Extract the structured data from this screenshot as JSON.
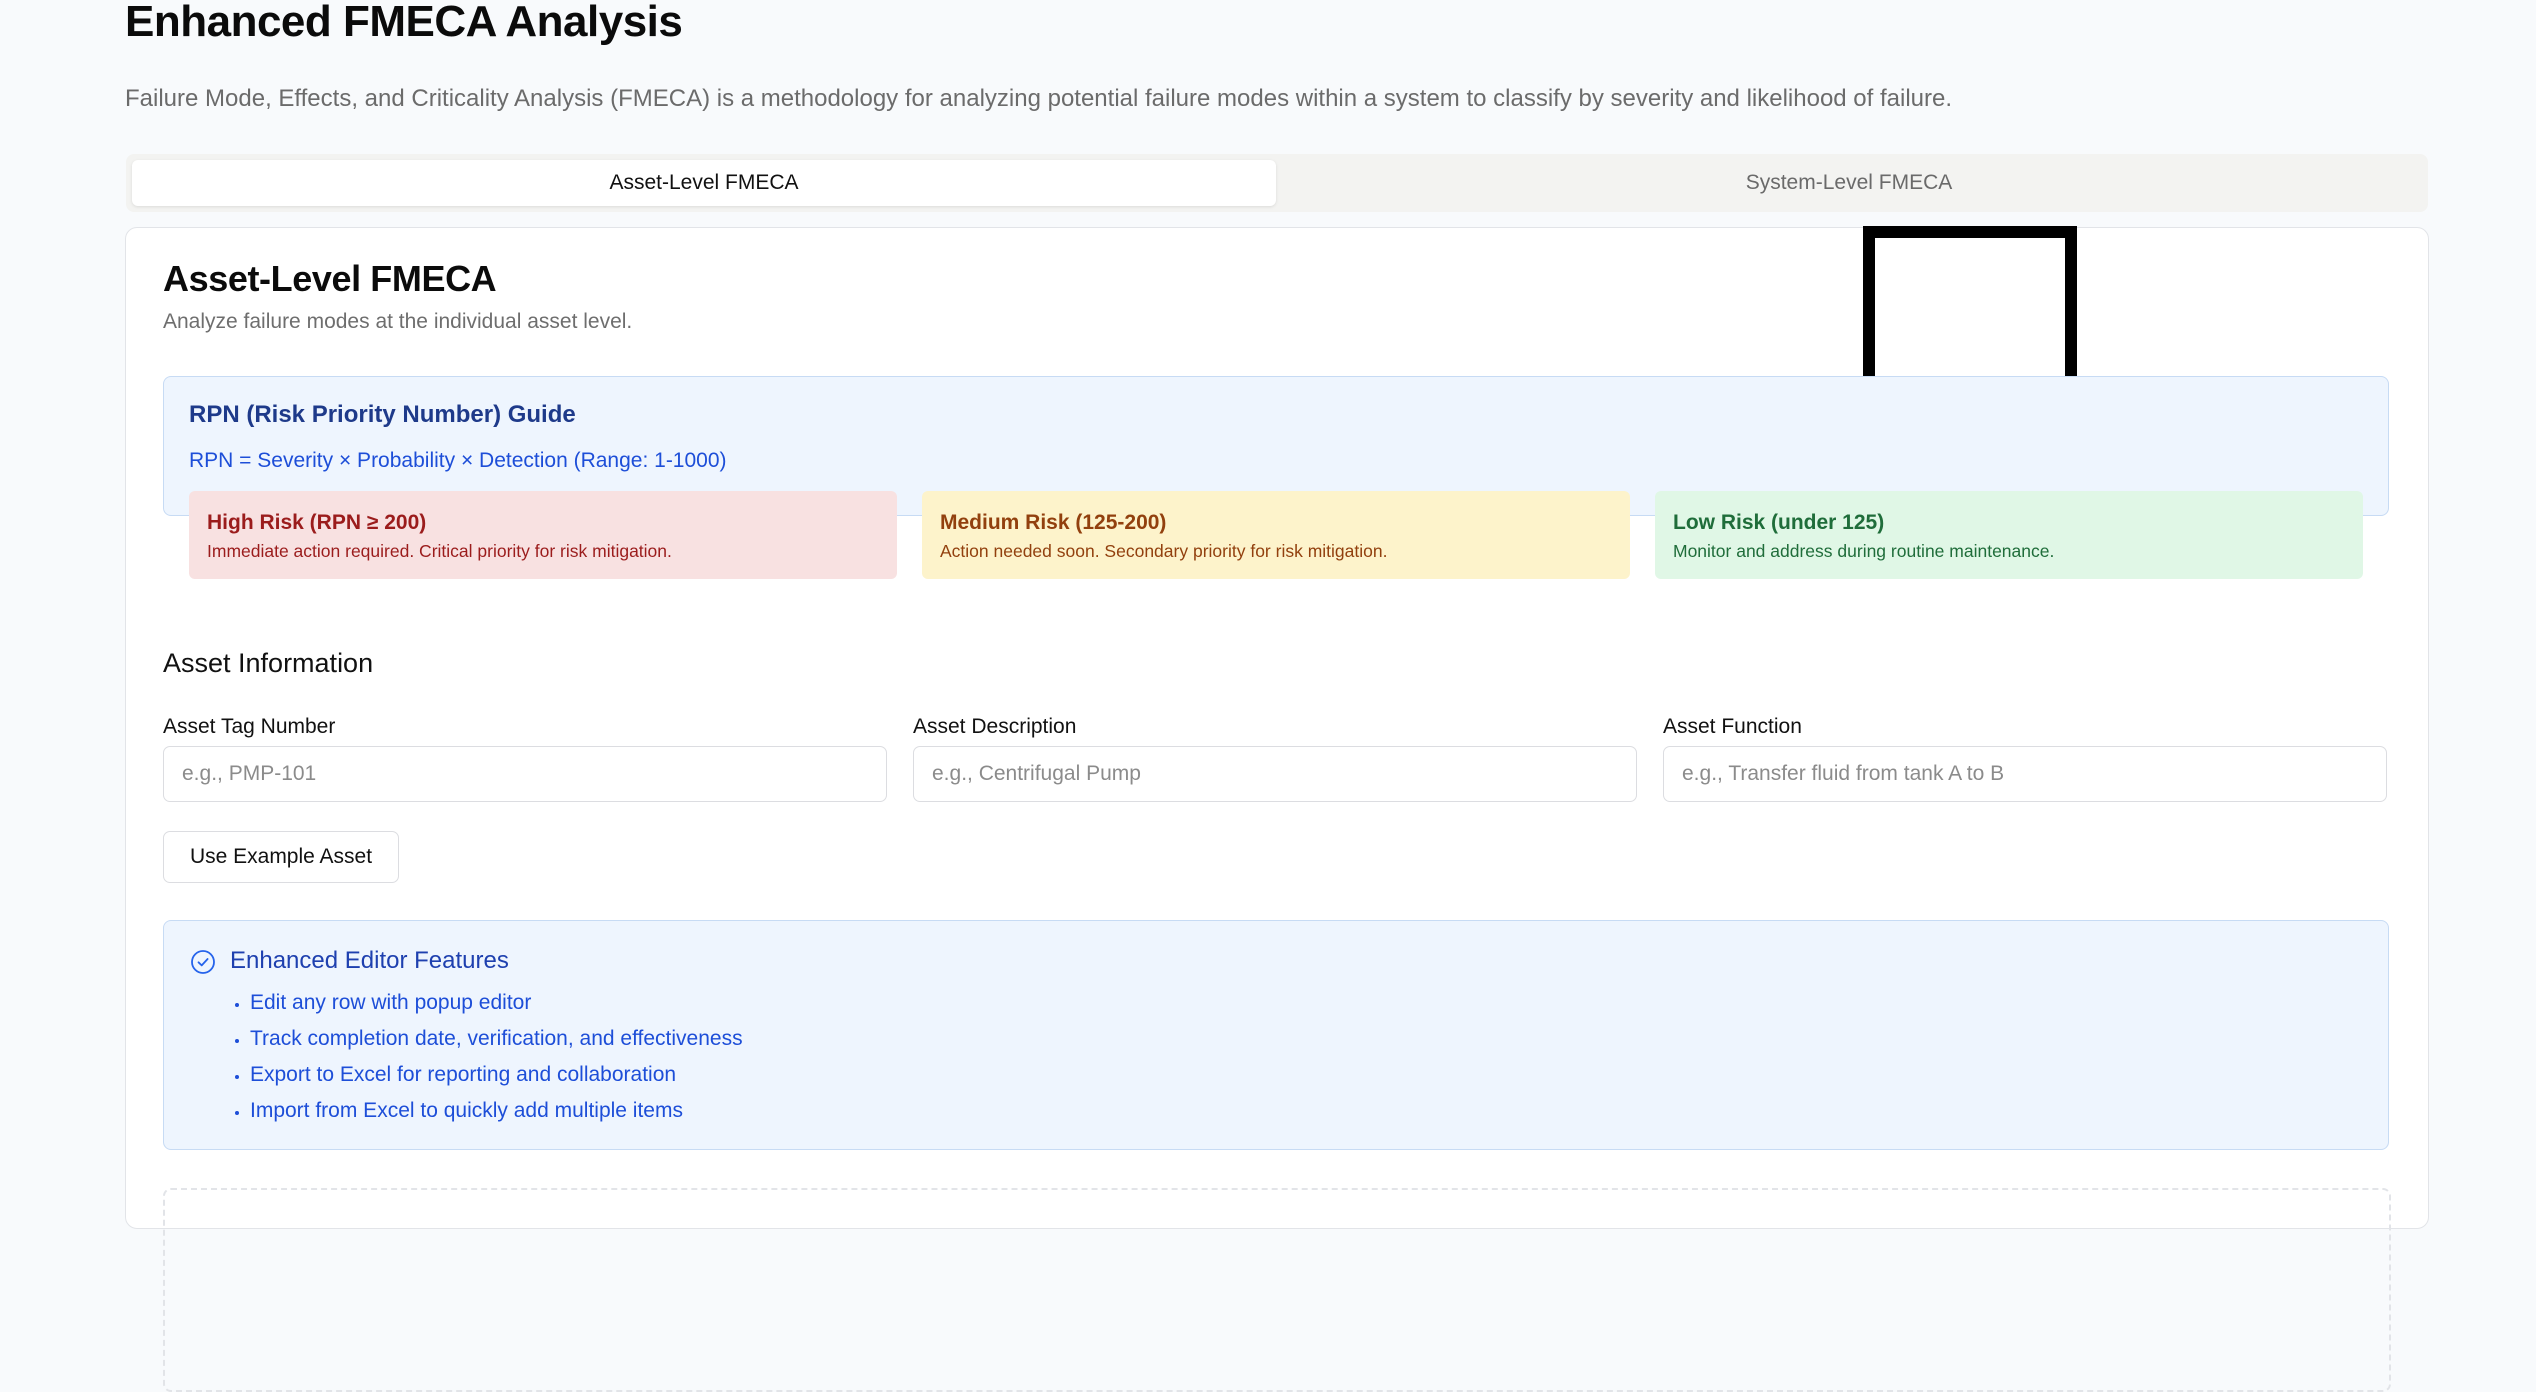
{
  "page": {
    "title": "Enhanced FMECA Analysis",
    "description": "Failure Mode, Effects, and Criticality Analysis (FMECA) is a methodology for analyzing potential failure modes within a system to classify by severity and likelihood of failure."
  },
  "tabs": [
    {
      "label": "Asset-Level FMECA",
      "active": true
    },
    {
      "label": "System-Level FMECA",
      "active": false
    }
  ],
  "card": {
    "title": "Asset-Level FMECA",
    "subtitle": "Analyze failure modes at the individual asset level."
  },
  "rpn_guide": {
    "title": "RPN (Risk Priority Number) Guide",
    "formula": "RPN = Severity × Probability × Detection (Range: 1-1000)",
    "levels": [
      {
        "title": "High Risk (RPN ≥ 200)",
        "description": "Immediate action required. Critical priority for risk mitigation.",
        "color": "#f8e1e1"
      },
      {
        "title": "Medium Risk (125-200)",
        "description": "Action needed soon. Secondary priority for risk mitigation.",
        "color": "#fdf3cb"
      },
      {
        "title": "Low Risk (under 125)",
        "description": "Monitor and address during routine maintenance.",
        "color": "#e0f7e6"
      }
    ]
  },
  "asset_info": {
    "title": "Asset Information",
    "fields": [
      {
        "label": "Asset Tag Number",
        "placeholder": "e.g., PMP-101",
        "value": ""
      },
      {
        "label": "Asset Description",
        "placeholder": "e.g., Centrifugal Pump",
        "value": ""
      },
      {
        "label": "Asset Function",
        "placeholder": "e.g., Transfer fluid from tank A to B",
        "value": ""
      }
    ],
    "example_button": "Use Example Asset"
  },
  "features": {
    "icon": "check-circle-icon",
    "title": "Enhanced Editor Features",
    "items": [
      "Edit any row with popup editor",
      "Track completion date, verification, and effectiveness",
      "Export to Excel for reporting and collaboration",
      "Import from Excel to quickly add multiple items"
    ]
  },
  "colors": {
    "accent_blue": "#1d4ed8",
    "info_bg": "#eef5fe"
  }
}
